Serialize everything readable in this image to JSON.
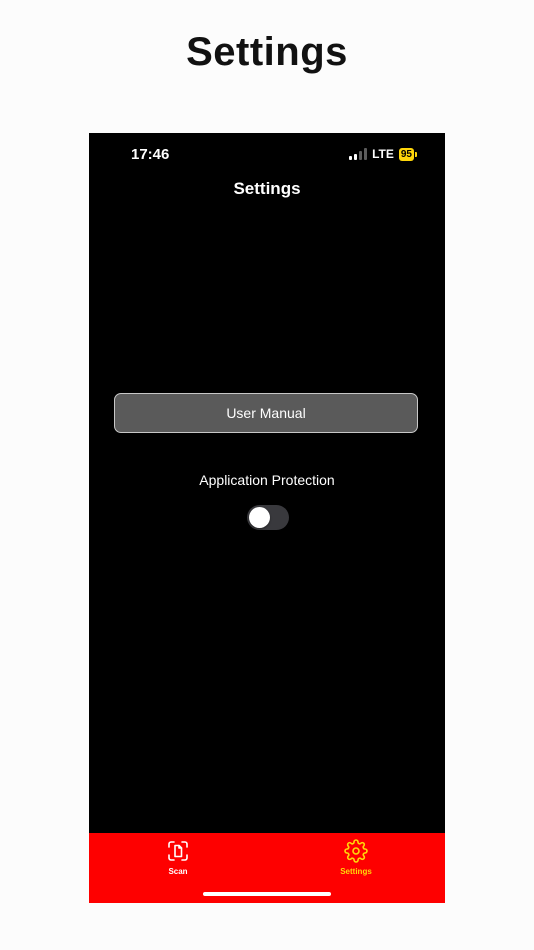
{
  "page": {
    "heading": "Settings"
  },
  "status_bar": {
    "time": "17:46",
    "network": "LTE",
    "battery": "95",
    "battery_color": "#ffd60a",
    "signal_bars_active": 2,
    "signal_bars_total": 4
  },
  "nav": {
    "title": "Settings"
  },
  "settings": {
    "user_manual_label": "User Manual",
    "protection_label": "Application Protection",
    "protection_enabled": false
  },
  "tab_bar": {
    "background_color": "#fe0000",
    "active_color": "#ffd60a",
    "inactive_color": "#ffffff",
    "tabs": [
      {
        "label": "Scan",
        "icon": "document-scan-icon",
        "active": false
      },
      {
        "label": "Settings",
        "icon": "gear-icon",
        "active": true
      }
    ]
  }
}
